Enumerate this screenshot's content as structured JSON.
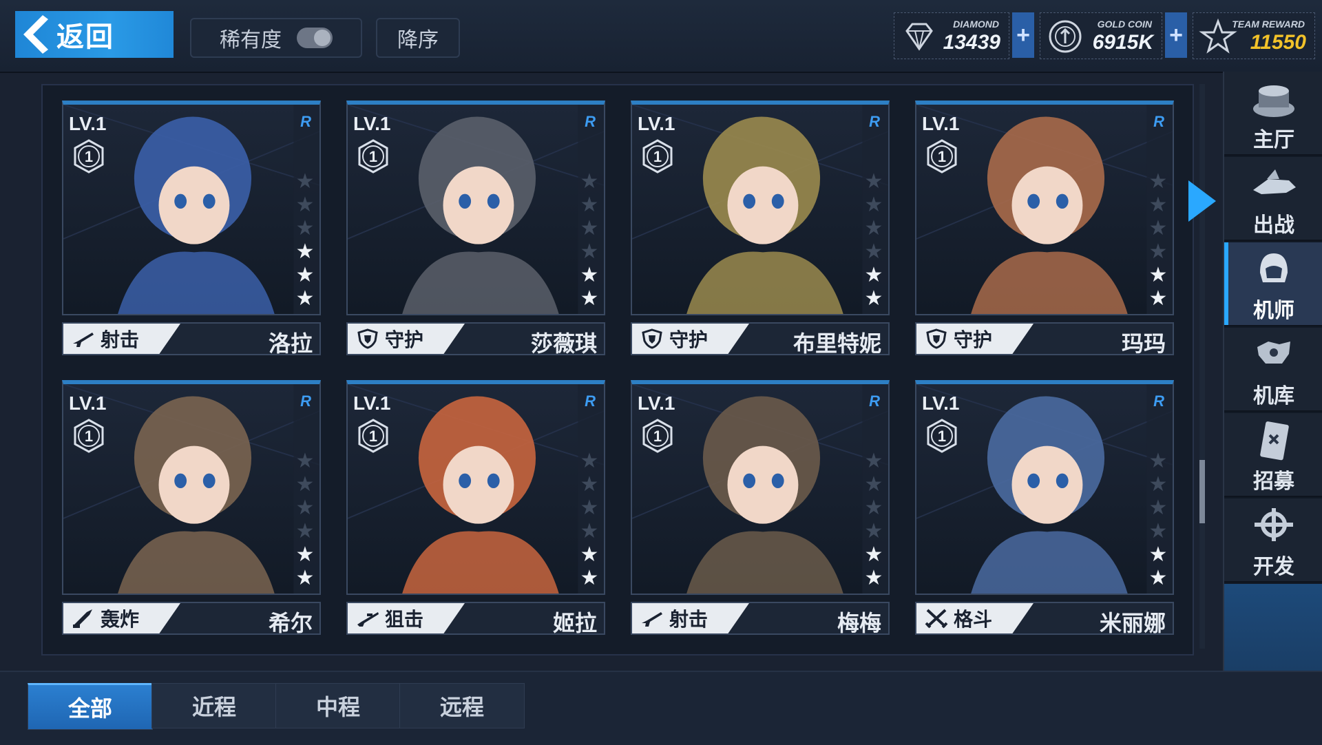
{
  "topbar": {
    "back_label": "返回",
    "sort_rarity_label": "稀有度",
    "sort_order_label": "降序",
    "diamond": {
      "caption": "DIAMOND",
      "value": "13439"
    },
    "gold": {
      "caption": "GOLD COIN",
      "value": "6915K"
    },
    "reward": {
      "caption": "TEAM REWARD",
      "value": "11550"
    }
  },
  "cards": [
    {
      "level": "LV.1",
      "badge": "1",
      "rarity": "R",
      "role": "射击",
      "name": "洛拉",
      "stars": 3,
      "role_icon": "rifle-icon",
      "art_color": "#3b5fa8"
    },
    {
      "level": "LV.1",
      "badge": "1",
      "rarity": "R",
      "role": "守护",
      "name": "莎薇琪",
      "stars": 2,
      "role_icon": "shield-icon",
      "art_color": "#5a5f6a"
    },
    {
      "level": "LV.1",
      "badge": "1",
      "rarity": "R",
      "role": "守护",
      "name": "布里特妮",
      "stars": 2,
      "role_icon": "shield-icon",
      "art_color": "#9a8a4e"
    },
    {
      "level": "LV.1",
      "badge": "1",
      "rarity": "R",
      "role": "守护",
      "name": "玛玛",
      "stars": 2,
      "role_icon": "shield-icon",
      "art_color": "#a86a4a"
    },
    {
      "level": "LV.1",
      "badge": "1",
      "rarity": "R",
      "role": "轰炸",
      "name": "希尔",
      "stars": 2,
      "role_icon": "rocket-icon",
      "art_color": "#7a6450"
    },
    {
      "level": "LV.1",
      "badge": "1",
      "rarity": "R",
      "role": "狙击",
      "name": "姬拉",
      "stars": 2,
      "role_icon": "sniper-icon",
      "art_color": "#c8653e"
    },
    {
      "level": "LV.1",
      "badge": "1",
      "rarity": "R",
      "role": "射击",
      "name": "梅梅",
      "stars": 2,
      "role_icon": "rifle-icon",
      "art_color": "#6a5a4a"
    },
    {
      "level": "LV.1",
      "badge": "1",
      "rarity": "R",
      "role": "格斗",
      "name": "米丽娜",
      "stars": 2,
      "role_icon": "swords-icon",
      "art_color": "#4a6aa0"
    }
  ],
  "sidenav": [
    {
      "label": "主厅",
      "icon": "hall-icon"
    },
    {
      "label": "出战",
      "icon": "sortie-icon"
    },
    {
      "label": "机师",
      "icon": "pilot-icon",
      "active": true
    },
    {
      "label": "机库",
      "icon": "hangar-icon"
    },
    {
      "label": "招募",
      "icon": "recruit-icon"
    },
    {
      "label": "开发",
      "icon": "develop-icon"
    }
  ],
  "tabs": [
    "全部",
    "近程",
    "中程",
    "远程"
  ],
  "colors": {
    "accent": "#2aa8ff",
    "active_tab": "#2b7fd0",
    "gold_value": "#f2c229"
  }
}
